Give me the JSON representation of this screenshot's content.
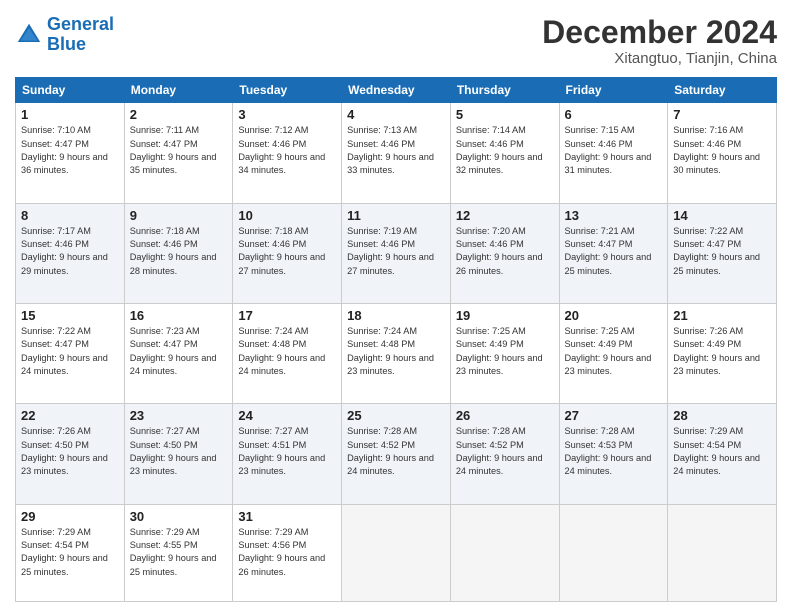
{
  "logo": {
    "line1": "General",
    "line2": "Blue"
  },
  "title": "December 2024",
  "subtitle": "Xitangtuo, Tianjin, China",
  "weekdays": [
    "Sunday",
    "Monday",
    "Tuesday",
    "Wednesday",
    "Thursday",
    "Friday",
    "Saturday"
  ],
  "weeks": [
    [
      {
        "day": "1",
        "sunrise": "7:10 AM",
        "sunset": "4:47 PM",
        "daylight": "9 hours and 36 minutes."
      },
      {
        "day": "2",
        "sunrise": "7:11 AM",
        "sunset": "4:47 PM",
        "daylight": "9 hours and 35 minutes."
      },
      {
        "day": "3",
        "sunrise": "7:12 AM",
        "sunset": "4:46 PM",
        "daylight": "9 hours and 34 minutes."
      },
      {
        "day": "4",
        "sunrise": "7:13 AM",
        "sunset": "4:46 PM",
        "daylight": "9 hours and 33 minutes."
      },
      {
        "day": "5",
        "sunrise": "7:14 AM",
        "sunset": "4:46 PM",
        "daylight": "9 hours and 32 minutes."
      },
      {
        "day": "6",
        "sunrise": "7:15 AM",
        "sunset": "4:46 PM",
        "daylight": "9 hours and 31 minutes."
      },
      {
        "day": "7",
        "sunrise": "7:16 AM",
        "sunset": "4:46 PM",
        "daylight": "9 hours and 30 minutes."
      }
    ],
    [
      {
        "day": "8",
        "sunrise": "7:17 AM",
        "sunset": "4:46 PM",
        "daylight": "9 hours and 29 minutes."
      },
      {
        "day": "9",
        "sunrise": "7:18 AM",
        "sunset": "4:46 PM",
        "daylight": "9 hours and 28 minutes."
      },
      {
        "day": "10",
        "sunrise": "7:18 AM",
        "sunset": "4:46 PM",
        "daylight": "9 hours and 27 minutes."
      },
      {
        "day": "11",
        "sunrise": "7:19 AM",
        "sunset": "4:46 PM",
        "daylight": "9 hours and 27 minutes."
      },
      {
        "day": "12",
        "sunrise": "7:20 AM",
        "sunset": "4:46 PM",
        "daylight": "9 hours and 26 minutes."
      },
      {
        "day": "13",
        "sunrise": "7:21 AM",
        "sunset": "4:47 PM",
        "daylight": "9 hours and 25 minutes."
      },
      {
        "day": "14",
        "sunrise": "7:22 AM",
        "sunset": "4:47 PM",
        "daylight": "9 hours and 25 minutes."
      }
    ],
    [
      {
        "day": "15",
        "sunrise": "7:22 AM",
        "sunset": "4:47 PM",
        "daylight": "9 hours and 24 minutes."
      },
      {
        "day": "16",
        "sunrise": "7:23 AM",
        "sunset": "4:47 PM",
        "daylight": "9 hours and 24 minutes."
      },
      {
        "day": "17",
        "sunrise": "7:24 AM",
        "sunset": "4:48 PM",
        "daylight": "9 hours and 24 minutes."
      },
      {
        "day": "18",
        "sunrise": "7:24 AM",
        "sunset": "4:48 PM",
        "daylight": "9 hours and 23 minutes."
      },
      {
        "day": "19",
        "sunrise": "7:25 AM",
        "sunset": "4:49 PM",
        "daylight": "9 hours and 23 minutes."
      },
      {
        "day": "20",
        "sunrise": "7:25 AM",
        "sunset": "4:49 PM",
        "daylight": "9 hours and 23 minutes."
      },
      {
        "day": "21",
        "sunrise": "7:26 AM",
        "sunset": "4:49 PM",
        "daylight": "9 hours and 23 minutes."
      }
    ],
    [
      {
        "day": "22",
        "sunrise": "7:26 AM",
        "sunset": "4:50 PM",
        "daylight": "9 hours and 23 minutes."
      },
      {
        "day": "23",
        "sunrise": "7:27 AM",
        "sunset": "4:50 PM",
        "daylight": "9 hours and 23 minutes."
      },
      {
        "day": "24",
        "sunrise": "7:27 AM",
        "sunset": "4:51 PM",
        "daylight": "9 hours and 23 minutes."
      },
      {
        "day": "25",
        "sunrise": "7:28 AM",
        "sunset": "4:52 PM",
        "daylight": "9 hours and 24 minutes."
      },
      {
        "day": "26",
        "sunrise": "7:28 AM",
        "sunset": "4:52 PM",
        "daylight": "9 hours and 24 minutes."
      },
      {
        "day": "27",
        "sunrise": "7:28 AM",
        "sunset": "4:53 PM",
        "daylight": "9 hours and 24 minutes."
      },
      {
        "day": "28",
        "sunrise": "7:29 AM",
        "sunset": "4:54 PM",
        "daylight": "9 hours and 24 minutes."
      }
    ],
    [
      {
        "day": "29",
        "sunrise": "7:29 AM",
        "sunset": "4:54 PM",
        "daylight": "9 hours and 25 minutes."
      },
      {
        "day": "30",
        "sunrise": "7:29 AM",
        "sunset": "4:55 PM",
        "daylight": "9 hours and 25 minutes."
      },
      {
        "day": "31",
        "sunrise": "7:29 AM",
        "sunset": "4:56 PM",
        "daylight": "9 hours and 26 minutes."
      },
      null,
      null,
      null,
      null
    ]
  ]
}
